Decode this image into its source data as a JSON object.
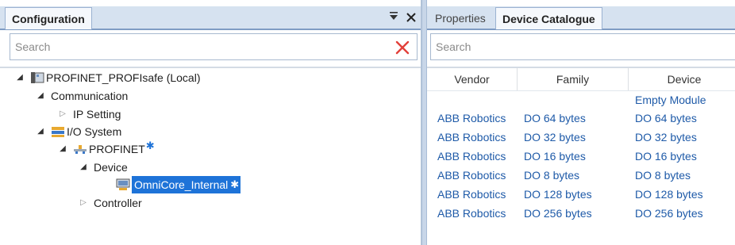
{
  "config_panel": {
    "tab_label": "Configuration",
    "search_placeholder": "Search",
    "tree": {
      "root": "PROFINET_PROFIsafe (Local)",
      "communication": "Communication",
      "ip_setting": "IP Setting",
      "io_system": "I/O System",
      "profinet": "PROFINET",
      "device": "Device",
      "omnicore": "OmniCore_Internal",
      "controller": "Controller"
    }
  },
  "catalogue_panel": {
    "tabs": [
      "Properties",
      "Device Catalogue"
    ],
    "search_placeholder": "Search",
    "columns": [
      "Vendor",
      "Family",
      "Device"
    ],
    "rows": [
      {
        "vendor": "",
        "family": "",
        "device": "Empty Module"
      },
      {
        "vendor": "ABB Robotics",
        "family": "DO 64 bytes",
        "device": "DO 64 bytes"
      },
      {
        "vendor": "ABB Robotics",
        "family": "DO 32 bytes",
        "device": "DO 32 bytes"
      },
      {
        "vendor": "ABB Robotics",
        "family": "DO 16 bytes",
        "device": "DO 16 bytes"
      },
      {
        "vendor": "ABB Robotics",
        "family": "DO 8 bytes",
        "device": "DO 8 bytes"
      },
      {
        "vendor": "ABB Robotics",
        "family": "DO 128 bytes",
        "device": "DO 128 bytes"
      },
      {
        "vendor": "ABB Robotics",
        "family": "DO 256 bytes",
        "device": "DO 256 bytes"
      }
    ]
  },
  "icons": {
    "tab_controls": [
      "dropdown-icon",
      "close-icon"
    ],
    "search_clear": "clear-search-icon"
  },
  "colors": {
    "accent": "#1e73d8",
    "link_text": "#1e5aa8",
    "tab_strip": "#d6e2f0",
    "clear_x": "#e2403a"
  }
}
